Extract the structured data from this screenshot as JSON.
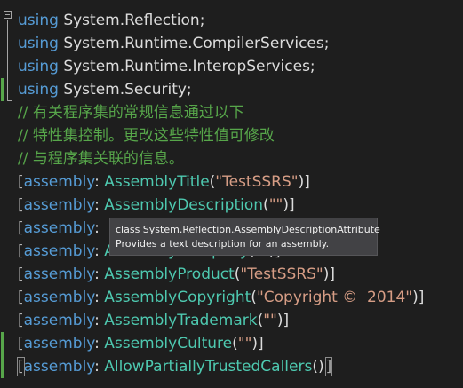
{
  "editor": {
    "lines": [
      {
        "parts": [
          {
            "c": "kw",
            "t": "using"
          },
          {
            "c": "tx",
            "t": " System.Reflection;"
          }
        ]
      },
      {
        "parts": [
          {
            "c": "kw",
            "t": "using"
          },
          {
            "c": "tx",
            "t": " System.Runtime.CompilerServices;"
          }
        ]
      },
      {
        "parts": [
          {
            "c": "kw",
            "t": "using"
          },
          {
            "c": "tx",
            "t": " System.Runtime.InteropServices;"
          }
        ]
      },
      {
        "parts": [
          {
            "c": "kw",
            "t": "using"
          },
          {
            "c": "tx",
            "t": " System.Security;"
          }
        ]
      },
      {
        "parts": [
          {
            "c": "cm",
            "t": "// 有关程序集的常规信息通过以下"
          }
        ]
      },
      {
        "parts": [
          {
            "c": "cm",
            "t": "// 特性集控制。更改这些特性值可修改"
          }
        ]
      },
      {
        "parts": [
          {
            "c": "cm",
            "t": "// 与程序集关联的信息。"
          }
        ]
      },
      {
        "parts": [
          {
            "c": "pn",
            "t": "["
          },
          {
            "c": "kw",
            "t": "assembly"
          },
          {
            "c": "tx",
            "t": ": "
          },
          {
            "c": "ty",
            "t": "AssemblyTitle"
          },
          {
            "c": "tx",
            "t": "("
          },
          {
            "c": "st",
            "t": "\"TestSSRS\""
          },
          {
            "c": "tx",
            "t": ")]"
          }
        ]
      },
      {
        "parts": [
          {
            "c": "pn",
            "t": "["
          },
          {
            "c": "kw",
            "t": "assembly"
          },
          {
            "c": "tx",
            "t": ": "
          },
          {
            "c": "ty",
            "t": "AssemblyDescription"
          },
          {
            "c": "tx",
            "t": "("
          },
          {
            "c": "st",
            "t": "\"\""
          },
          {
            "c": "tx",
            "t": ")]"
          }
        ]
      },
      {
        "parts": [
          {
            "c": "pn",
            "t": "["
          },
          {
            "c": "kw",
            "t": "assembly"
          },
          {
            "c": "tx",
            "t": ": "
          }
        ]
      },
      {
        "parts": [
          {
            "c": "pn",
            "t": "["
          },
          {
            "c": "kw",
            "t": "assembly"
          },
          {
            "c": "tx",
            "t": ": "
          },
          {
            "c": "ty",
            "t": "AssemblyCompany"
          },
          {
            "c": "tx",
            "t": "("
          },
          {
            "c": "st",
            "t": "\"\""
          },
          {
            "c": "tx",
            "t": ")]"
          }
        ]
      },
      {
        "parts": [
          {
            "c": "pn",
            "t": "["
          },
          {
            "c": "kw",
            "t": "assembly"
          },
          {
            "c": "tx",
            "t": ": "
          },
          {
            "c": "ty",
            "t": "AssemblyProduct"
          },
          {
            "c": "tx",
            "t": "("
          },
          {
            "c": "st",
            "t": "\"TestSSRS\""
          },
          {
            "c": "tx",
            "t": ")]"
          }
        ]
      },
      {
        "parts": [
          {
            "c": "pn",
            "t": "["
          },
          {
            "c": "kw",
            "t": "assembly"
          },
          {
            "c": "tx",
            "t": ": "
          },
          {
            "c": "ty",
            "t": "AssemblyCopyright"
          },
          {
            "c": "tx",
            "t": "("
          },
          {
            "c": "st",
            "t": "\"Copyright ©  2014\""
          },
          {
            "c": "tx",
            "t": ")]"
          }
        ]
      },
      {
        "parts": [
          {
            "c": "pn",
            "t": "["
          },
          {
            "c": "kw",
            "t": "assembly"
          },
          {
            "c": "tx",
            "t": ": "
          },
          {
            "c": "ty",
            "t": "AssemblyTrademark"
          },
          {
            "c": "tx",
            "t": "("
          },
          {
            "c": "st",
            "t": "\"\""
          },
          {
            "c": "tx",
            "t": ")]"
          }
        ]
      },
      {
        "parts": [
          {
            "c": "pn",
            "t": "["
          },
          {
            "c": "kw",
            "t": "assembly"
          },
          {
            "c": "tx",
            "t": ": "
          },
          {
            "c": "ty",
            "t": "AssemblyCulture"
          },
          {
            "c": "tx",
            "t": "("
          },
          {
            "c": "st",
            "t": "\"\""
          },
          {
            "c": "tx",
            "t": ")]"
          }
        ]
      },
      {
        "parts": [
          {
            "c": "pn hl",
            "t": "["
          },
          {
            "c": "kw",
            "t": "assembly"
          },
          {
            "c": "tx",
            "t": ": "
          },
          {
            "c": "ty",
            "t": "AllowPartiallyTrustedCallers"
          },
          {
            "c": "tx",
            "t": "()"
          },
          {
            "c": "pn hl",
            "t": "]"
          }
        ]
      }
    ]
  },
  "tooltip": {
    "line1": "class System.Reflection.AssemblyDescriptionAttribute",
    "line2": "Provides a text description for an assembly."
  },
  "colors": {
    "background": "#1e1e1e",
    "keyword": "#569cd6",
    "type": "#4ec9b0",
    "string": "#d69d85",
    "comment": "#57a64a",
    "change_bar": "#57a64a"
  },
  "icons": {
    "collapse": "collapse-minus-icon"
  }
}
